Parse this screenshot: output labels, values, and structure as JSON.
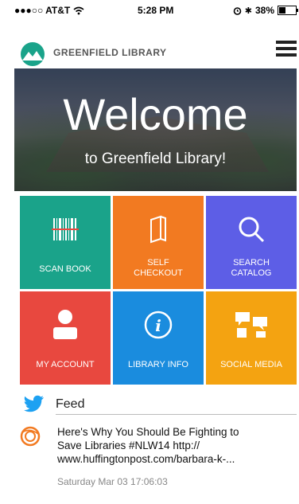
{
  "status_bar": {
    "carrier": "●●●○○ AT&T",
    "time": "5:28 PM",
    "battery": "38%",
    "battery_level": 0.38
  },
  "header": {
    "title": "GREENFIELD LIBRARY",
    "logo_icon": "mountain-logo-icon",
    "menu_icon": "hamburger-menu-icon"
  },
  "hero": {
    "title": "Welcome",
    "subtitle": "to Greenfield Library!"
  },
  "tiles": [
    {
      "label": "SCAN BOOK",
      "icon": "barcode-icon",
      "color": "#1aa38a"
    },
    {
      "label_line1": "SELF",
      "label_line2": "CHECKOUT",
      "icon": "book-icon",
      "color": "#f27a21"
    },
    {
      "label_line1": "SEARCH",
      "label_line2": "CATALOG",
      "icon": "search-icon",
      "color": "#5d5ee6"
    },
    {
      "label": "MY ACCOUNT",
      "icon": "user-icon",
      "color": "#e8483f"
    },
    {
      "label": "LIBRARY INFO",
      "icon": "info-icon",
      "color": "#1a8cde"
    },
    {
      "label": "SOCIAL MEDIA",
      "icon": "social-media-icon",
      "color": "#f4a311"
    }
  ],
  "feed": {
    "title": "Feed",
    "icon": "twitter-icon",
    "item": {
      "line1": "Here's Why You Should Be Fighting to",
      "line2": "Save Libraries  #NLW14 http://",
      "line3": "www.huffingtonpost.com/barbara-k-...",
      "timestamp": "Saturday Mar 03 17:06:03",
      "avatar_icon": "orange-ring-avatar-icon"
    }
  }
}
